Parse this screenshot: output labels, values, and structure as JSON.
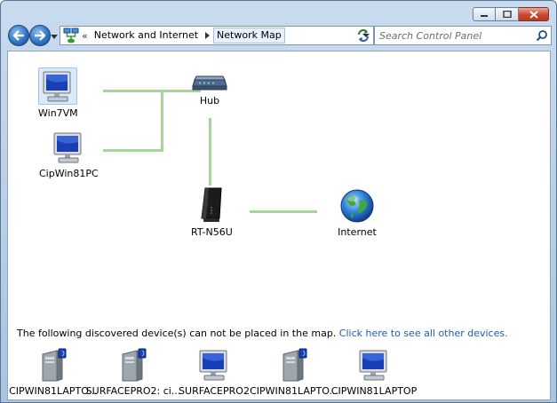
{
  "window": {
    "caption_buttons": [
      "minimize-icon",
      "maximize-icon",
      "close-icon"
    ]
  },
  "navigation": {
    "address": {
      "overflow": "«",
      "crumbs": [
        "Network and Internet",
        "Network Map"
      ]
    },
    "search": {
      "placeholder": "Search Control Panel"
    }
  },
  "map": {
    "nodes": [
      {
        "label": "Win7VM",
        "icon": "computer-icon"
      },
      {
        "label": "CipWin81PC",
        "icon": "computer-icon"
      },
      {
        "label": "Hub",
        "icon": "hub-icon"
      },
      {
        "label": "RT-N56U",
        "icon": "router-icon"
      },
      {
        "label": "Internet",
        "icon": "globe-icon"
      }
    ]
  },
  "discovered": {
    "message": "The following discovered device(s) can not be placed in the map.",
    "link": "Click here to see all other devices.",
    "devices": [
      {
        "label": "CIPWIN81LAPTO...",
        "icon": "tower-computer-icon"
      },
      {
        "label": "SURFACEPRO2: ci...",
        "icon": "tower-computer-icon"
      },
      {
        "label": "SURFACEPRO2",
        "icon": "computer-icon"
      },
      {
        "label": "CIPWIN81LAPTO...",
        "icon": "tower-computer-icon"
      },
      {
        "label": "CIPWIN81LAPTOP",
        "icon": "computer-icon"
      }
    ]
  },
  "colors": {
    "link_line": "#a6d59b",
    "hyperlink": "#1a5cb8",
    "window_frame": "#b6cde6"
  }
}
